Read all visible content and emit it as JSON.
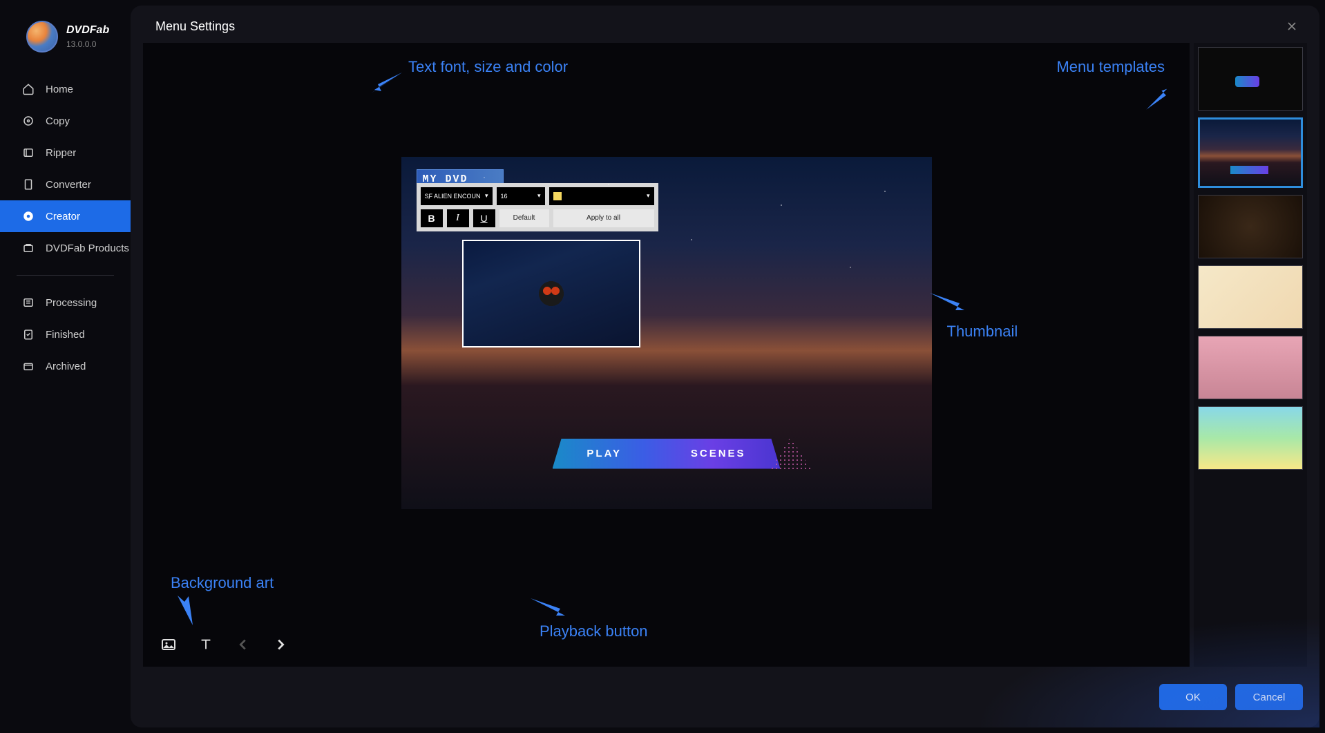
{
  "app": {
    "name": "DVDFab",
    "version": "13.0.0.0"
  },
  "sidebar": {
    "items": [
      {
        "label": "Home",
        "icon": "home"
      },
      {
        "label": "Copy",
        "icon": "copy"
      },
      {
        "label": "Ripper",
        "icon": "ripper"
      },
      {
        "label": "Converter",
        "icon": "converter"
      },
      {
        "label": "Creator",
        "icon": "creator",
        "active": true
      },
      {
        "label": "DVDFab Products",
        "icon": "products"
      }
    ],
    "bottom_items": [
      {
        "label": "Processing",
        "icon": "processing"
      },
      {
        "label": "Finished",
        "icon": "finished"
      },
      {
        "label": "Archived",
        "icon": "archived"
      }
    ]
  },
  "dialog": {
    "title": "Menu Settings",
    "ok": "OK",
    "cancel": "Cancel"
  },
  "canvas": {
    "dvd_title": "MY DVD",
    "font_name": "SF ALIEN ENCOUN",
    "font_size": "16",
    "btn_default": "Default",
    "btn_apply_all": "Apply to all",
    "play_label": "PLAY",
    "scenes_label": "SCENES",
    "color_hex": "#f5d860"
  },
  "annotations": {
    "text_font": "Text font, size and color",
    "menu_templates": "Menu templates",
    "thumbnail": "Thumbnail",
    "background_art": "Background art",
    "playback_button": "Playback button"
  },
  "templates": {
    "selected_index": 1,
    "count": 6
  }
}
